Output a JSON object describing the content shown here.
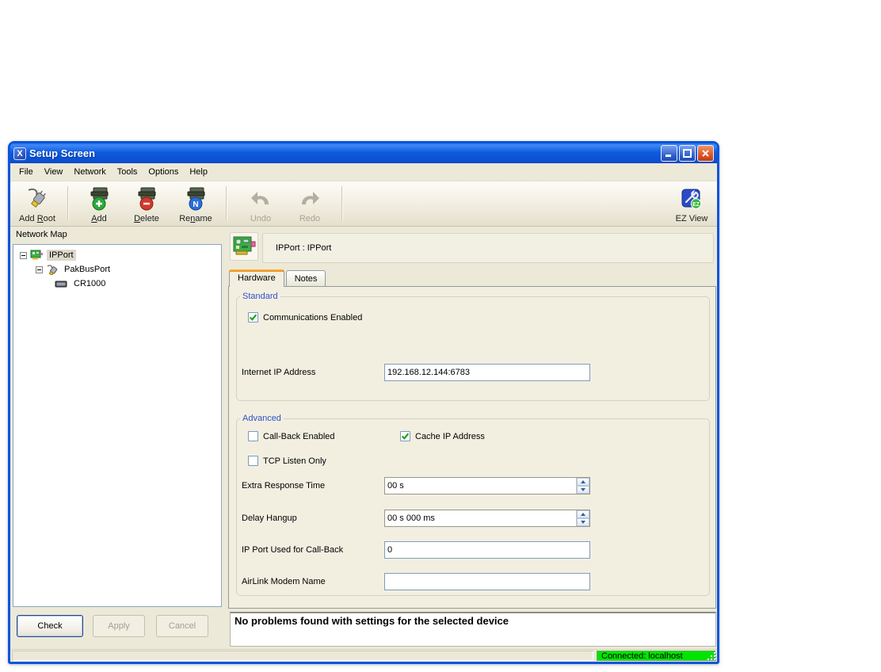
{
  "window": {
    "title": "Setup Screen"
  },
  "menu": {
    "items": [
      {
        "label": "File"
      },
      {
        "label": "View"
      },
      {
        "label": "Network"
      },
      {
        "label": "Tools"
      },
      {
        "label": "Options"
      },
      {
        "label": "Help"
      }
    ]
  },
  "toolbar": {
    "buttons": [
      {
        "name": "add-root",
        "pre": "Add ",
        "key": "R",
        "post": "oot"
      },
      {
        "name": "add",
        "pre": "",
        "key": "A",
        "post": "dd"
      },
      {
        "name": "delete",
        "pre": "",
        "key": "D",
        "post": "elete"
      },
      {
        "name": "rename",
        "pre": "Re",
        "key": "n",
        "post": "ame"
      },
      {
        "name": "undo",
        "pre": "",
        "key": "",
        "post": "Undo",
        "disabled": true
      },
      {
        "name": "redo",
        "pre": "",
        "key": "",
        "post": "Redo",
        "disabled": true
      }
    ],
    "ez_view": {
      "label": "EZ View"
    }
  },
  "sidebar": {
    "title": "Network Map",
    "tree": [
      {
        "label": "IPPort",
        "icon": "network-card-icon",
        "expanded": true,
        "selected": true
      },
      {
        "label": "PakBusPort",
        "icon": "plug-icon",
        "expanded": true,
        "selected": false
      },
      {
        "label": "CR1000",
        "icon": "datalogger-icon",
        "expanded": false,
        "selected": false
      }
    ],
    "buttons": {
      "check": "Check",
      "apply": "Apply",
      "cancel": "Cancel"
    }
  },
  "main": {
    "device_header": {
      "label": "IPPort : IPPort"
    },
    "tabs": [
      {
        "label": "Hardware",
        "active": true
      },
      {
        "label": "Notes",
        "active": false
      }
    ],
    "hardware": {
      "standard": {
        "legend": "Standard",
        "communications_enabled": {
          "label": "Communications Enabled",
          "checked": true
        },
        "internet_ip_address": {
          "label": "Internet IP Address",
          "value": "192.168.12.144:6783"
        }
      },
      "advanced": {
        "legend": "Advanced",
        "call_back_enabled": {
          "label": "Call-Back Enabled",
          "checked": false
        },
        "cache_ip_address": {
          "label": "Cache IP Address",
          "checked": true
        },
        "tcp_listen_only": {
          "label": "TCP Listen Only",
          "checked": false
        },
        "extra_response_time": {
          "label": "Extra Response Time",
          "value": "00 s"
        },
        "delay_hangup": {
          "label": "Delay Hangup",
          "value": "00 s 000 ms"
        },
        "ip_port_call_back": {
          "label": "IP Port Used for Call-Back",
          "value": "0"
        },
        "airlink_modem_name": {
          "label": "AirLink Modem Name",
          "value": ""
        }
      }
    },
    "message": "No problems found with settings for the selected device"
  },
  "statusbar": {
    "connection": "Connected: localhost",
    "connection_color": "#00E400"
  }
}
